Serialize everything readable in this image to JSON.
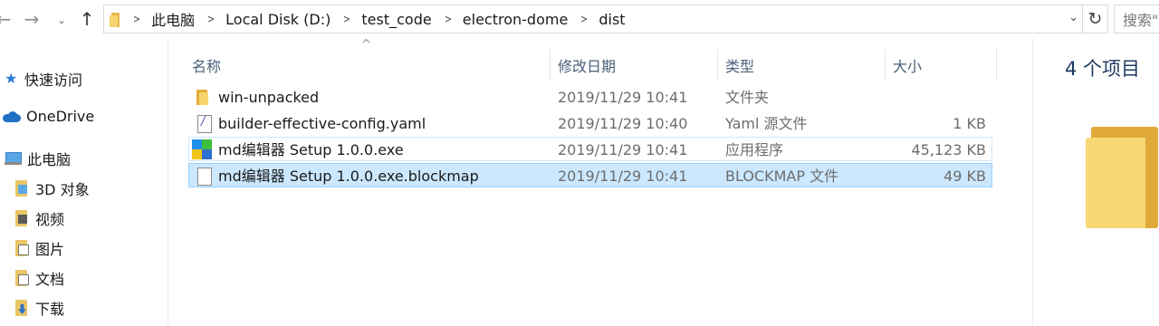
{
  "toolbar": {
    "back_icon": "←",
    "forward_icon": "→",
    "recent_icon": "⌄",
    "up_icon": "↑",
    "refresh_icon": "↻",
    "dropdown_icon": "⌄",
    "search_placeholder": "搜索\"dist\""
  },
  "breadcrumb": [
    "此电脑",
    "Local Disk (D:)",
    "test_code",
    "electron-dome",
    "dist"
  ],
  "sidebar": {
    "items": [
      {
        "label": "快速访问",
        "icon": "star-icon"
      },
      {
        "label": "OneDrive",
        "icon": "cloud-icon"
      },
      {
        "label": "此电脑",
        "icon": "computer-icon"
      },
      {
        "label": "3D 对象",
        "icon": "3d-objects-icon"
      },
      {
        "label": "视频",
        "icon": "video-icon"
      },
      {
        "label": "图片",
        "icon": "pictures-icon"
      },
      {
        "label": "文档",
        "icon": "documents-icon"
      },
      {
        "label": "下载",
        "icon": "downloads-icon"
      }
    ]
  },
  "columns": {
    "name": "名称",
    "date": "修改日期",
    "type": "类型",
    "size": "大小",
    "sort_indicator": "^"
  },
  "files": [
    {
      "name": "win-unpacked",
      "date": "2019/11/29 10:41",
      "type": "文件夹",
      "size": "",
      "icon": "folder-icon"
    },
    {
      "name": "builder-effective-config.yaml",
      "date": "2019/11/29 10:40",
      "type": "Yaml 源文件",
      "size": "1 KB",
      "icon": "yaml-file-icon"
    },
    {
      "name": "md编辑器 Setup 1.0.0.exe",
      "date": "2019/11/29 10:41",
      "type": "应用程序",
      "size": "45,123 KB",
      "icon": "exe-icon"
    },
    {
      "name": "md编辑器 Setup 1.0.0.exe.blockmap",
      "date": "2019/11/29 10:41",
      "type": "BLOCKMAP 文件",
      "size": "49 KB",
      "icon": "blank-file-icon"
    }
  ],
  "details": {
    "item_count": "4 个项目"
  },
  "colors": {
    "selection_bg": "#cce8ff",
    "selection_border": "#99d1ff",
    "header_text": "#4c607a",
    "folder_yellow": "#f8d775"
  }
}
